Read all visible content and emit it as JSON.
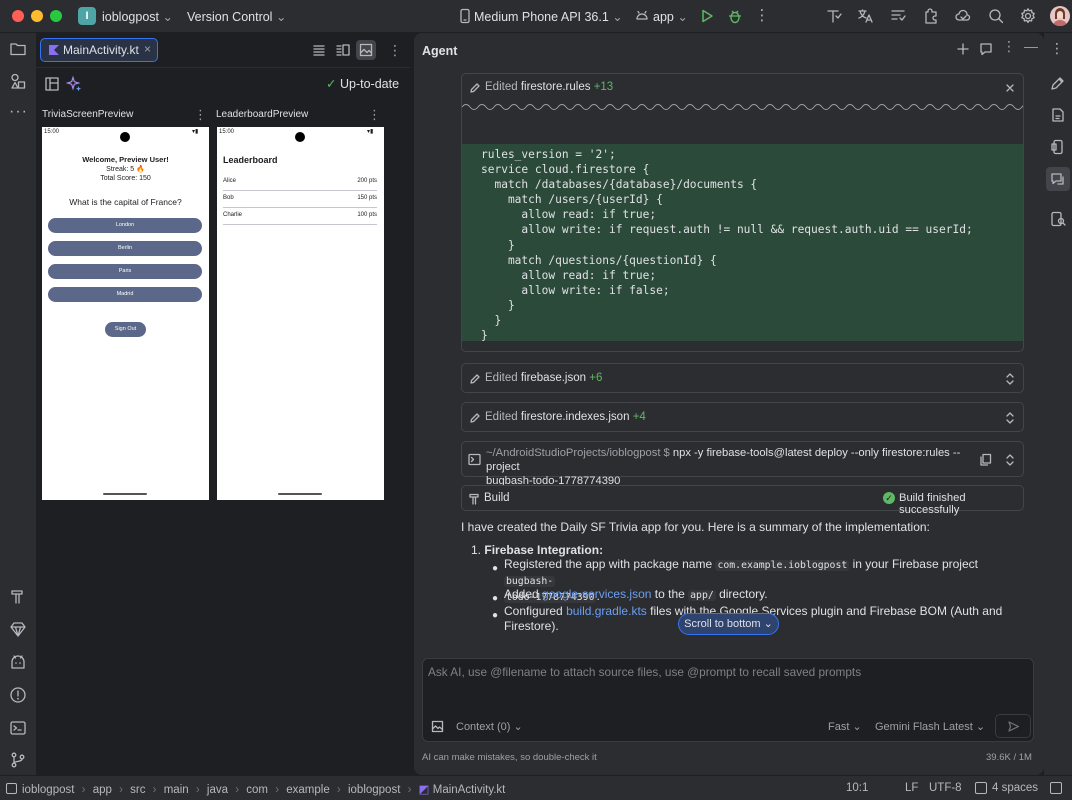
{
  "titlebar": {
    "project_badge": "I",
    "project_name": "ioblogpost",
    "vcs": "Version Control",
    "device": "Medium Phone API 36.1",
    "run_config": "app",
    "avatar_color": "#e8c6c6"
  },
  "editor": {
    "tab_label": "MainActivity.kt",
    "status": "Up-to-date",
    "preview1_title": "TriviaScreenPreview",
    "preview2_title": "LeaderboardPreview",
    "preview1": {
      "time": "15:00",
      "welcome": "Welcome, Preview User!",
      "streak": "Streak: 5 🔥",
      "score": "Total Score: 150",
      "question": "What is the capital of France?",
      "options": [
        "London",
        "Berlin",
        "Paris",
        "Madrid"
      ],
      "signout": "Sign Out"
    },
    "preview2": {
      "time": "15:00",
      "title": "Leaderboard",
      "rows": [
        {
          "name": "Alice",
          "score": "200 pts"
        },
        {
          "name": "Bob",
          "score": "150 pts"
        },
        {
          "name": "Charlie",
          "score": "100 pts"
        }
      ]
    }
  },
  "agent": {
    "title": "Agent",
    "card1": {
      "verb": "Edited",
      "file": "firestore.rules",
      "delta": "+13"
    },
    "code_lines": [
      "rules_version = '2';",
      "service cloud.firestore {",
      "  match /databases/{database}/documents {",
      "    match /users/{userId} {",
      "      allow read: if true;",
      "      allow write: if request.auth != null && request.auth.uid == userId;",
      "    }",
      "    match /questions/{questionId} {",
      "      allow read: if true;",
      "      allow write: if false;",
      "    }",
      "  }",
      "}"
    ],
    "card2": {
      "verb": "Edited",
      "file": "firebase.json",
      "delta": "+6"
    },
    "card3": {
      "verb": "Edited",
      "file": "firestore.indexes.json",
      "delta": "+4"
    },
    "terminal": {
      "path": "~/AndroidStudioProjects/ioblogpost $",
      "command": "npx -y firebase-tools@latest deploy --only firestore:rules --project",
      "command2": "bugbash-todo-1778774390"
    },
    "build": {
      "label": "Build",
      "status": "Build finished successfully"
    },
    "summary": "I have created the Daily SF Trivia app for you. Here is a summary of the implementation:",
    "list_num": "1.",
    "list_title": "Firebase Integration",
    "list_colon": ":",
    "b1_a": "Registered the app with package name",
    "b1_pkg": "com.example.ioblogpost",
    "b1_b": "in your Firebase project",
    "b1_proj1": "bugbash-",
    "b1_proj2": "todo-1778774390",
    "b1_end": ".",
    "b2_a": "Added",
    "b2_link": "google-services.json",
    "b2_b": "to the",
    "b2_dir": "app/",
    "b2_c": "directory.",
    "b3_a": "Configured",
    "b3_link": "build.gradle.kts",
    "b3_b": "files with the Google Services plugin and Firebase BOM (Auth and",
    "b3_c": "Firestore).",
    "scroll_btn": "Scroll to bottom",
    "input_placeholder": "Ask AI, use @filename to attach source files, use @prompt to recall saved prompts",
    "context": "Context (0)",
    "speed": "Fast",
    "model": "Gemini Flash Latest",
    "disclaimer": "AI can make mistakes, so double-check it",
    "tokens": "39.6K / 1M"
  },
  "statusbar": {
    "crumbs": [
      "ioblogpost",
      "app",
      "src",
      "main",
      "java",
      "com",
      "example",
      "ioblogpost",
      "MainActivity.kt"
    ],
    "position": "10:1",
    "line_ending": "LF",
    "encoding": "UTF-8",
    "indent": "4 spaces"
  },
  "colors": {
    "accent": "#3574f0",
    "diff_bg": "#2c4a3a",
    "success": "#5fb865",
    "button": "#5c6889"
  }
}
